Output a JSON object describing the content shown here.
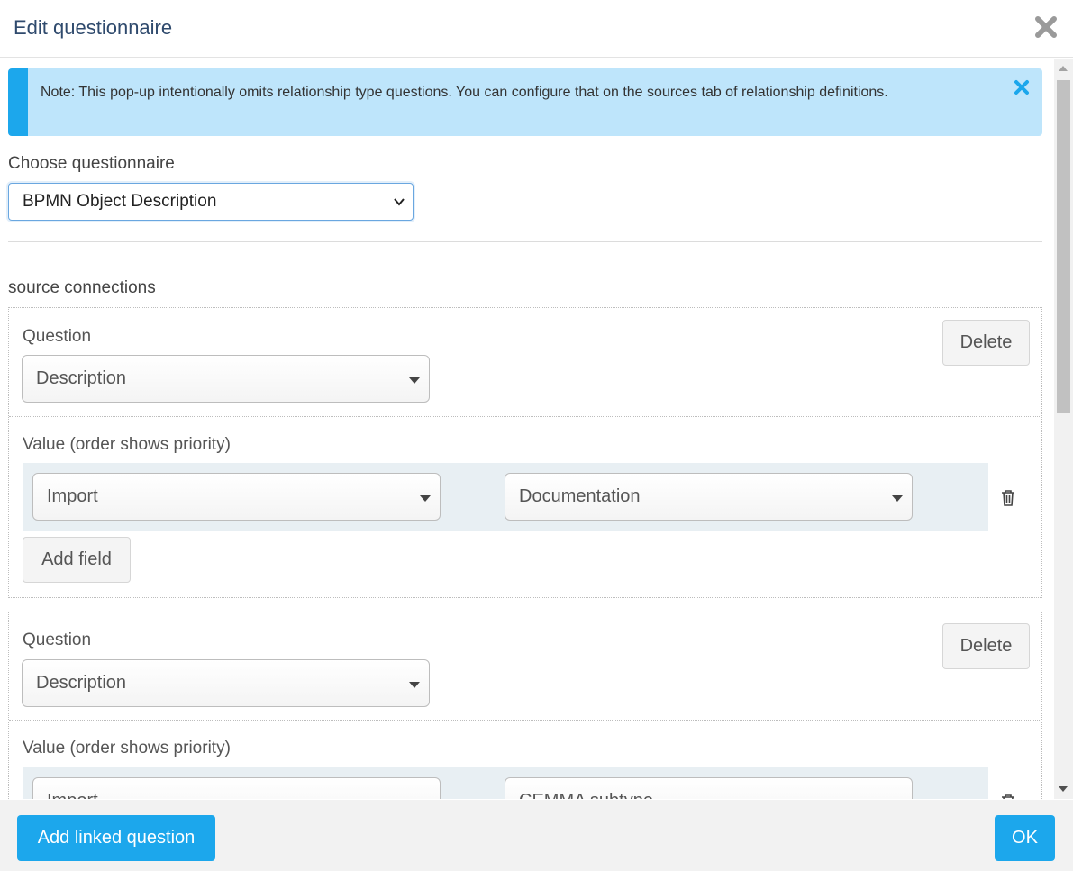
{
  "dialog": {
    "title": "Edit questionnaire"
  },
  "note": {
    "text": "Note: This pop-up intentionally omits relationship type questions. You can configure that on the sources tab of relationship definitions."
  },
  "choose": {
    "label": "Choose questionnaire",
    "selected": "BPMN Object Description"
  },
  "section": {
    "title": "source connections"
  },
  "blocks": [
    {
      "question_label": "Question",
      "question_value": "Description",
      "delete_label": "Delete",
      "value_label": "Value (order shows priority)",
      "fields": [
        {
          "source": "Import",
          "field": "Documentation"
        }
      ],
      "add_field_label": "Add field"
    },
    {
      "question_label": "Question",
      "question_value": "Description",
      "delete_label": "Delete",
      "value_label": "Value (order shows priority)",
      "fields": [
        {
          "source": "Import",
          "field": "CEMMA subtype"
        }
      ]
    }
  ],
  "footer": {
    "add_linked_label": "Add linked question",
    "ok_label": "OK"
  },
  "colors": {
    "accent": "#1ca7ec",
    "note_bg": "#bee5fb",
    "title": "#2f4a6d"
  },
  "icons": [
    "close-icon",
    "note-close-icon",
    "chevron-down-icon",
    "caret-down-icon",
    "trash-icon"
  ]
}
